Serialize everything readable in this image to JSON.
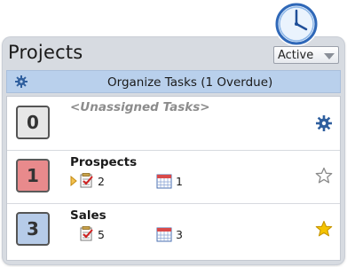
{
  "header": {
    "title": "Projects",
    "filter_value": "Active"
  },
  "organize_bar": {
    "label": "Organize Tasks (1 Overdue)"
  },
  "projects": [
    {
      "number": "0",
      "name": "<Unassigned Tasks>",
      "right_icon": "gear-icon",
      "color": "#e6e6e6"
    },
    {
      "number": "1",
      "name": "Prospects",
      "tasks_count": "2",
      "calendar_count": "1",
      "right_icon": "star-outline-icon",
      "color": "#e88a8c"
    },
    {
      "number": "3",
      "name": "Sales",
      "tasks_count": "5",
      "calendar_count": "3",
      "right_icon": "star-filled-icon",
      "color": "#b6cbe8"
    }
  ],
  "colors": {
    "accent_bar": "#b9d0ec",
    "star_filled": "#f5c400",
    "gear": "#2f5f9e"
  }
}
